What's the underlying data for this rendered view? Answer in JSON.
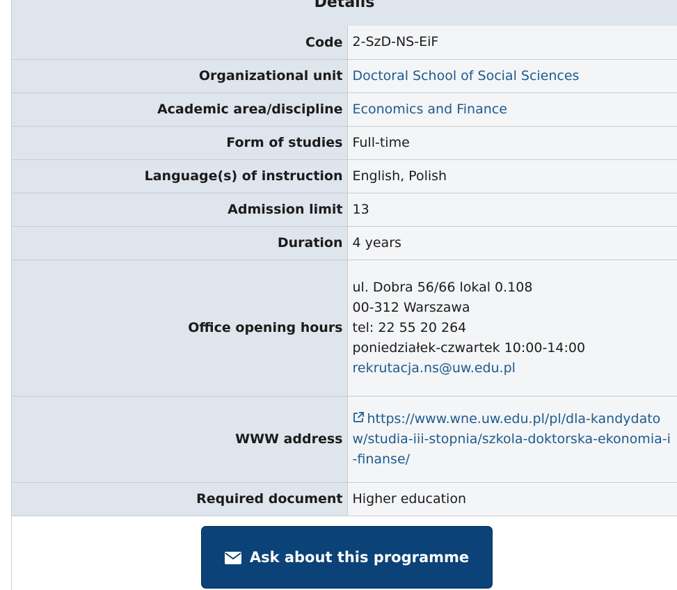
{
  "section_title": "Details",
  "details": {
    "code": {
      "label": "Code",
      "value": "2-SzD-NS-EiF"
    },
    "organizational_unit": {
      "label": "Organizational unit",
      "value": "Doctoral School of Social Sciences"
    },
    "academic_area": {
      "label": "Academic area/discipline",
      "value": "Economics and Finance"
    },
    "form_of_studies": {
      "label": "Form of studies",
      "value": "Full-time"
    },
    "languages": {
      "label": "Language(s) of instruction",
      "value": "English, Polish"
    },
    "admission_limit": {
      "label": "Admission limit",
      "value": "13"
    },
    "duration": {
      "label": "Duration",
      "value": "4 years"
    },
    "office_hours": {
      "label": "Office opening hours",
      "address": "ul. Dobra 56/66 lokal 0.108",
      "city": "00-312 Warszawa",
      "phone": "tel: 22 55 20 264",
      "hours": "poniedziałek-czwartek 10:00-14:00",
      "email": "rekrutacja.ns@uw.edu.pl"
    },
    "www_address": {
      "label": "WWW address",
      "value": "https://www.wne.uw.edu.pl/pl/dla-kandydatow/studia-iii-stopnia/szkola-doktorska-ekonomia-i-finanse/",
      "icon": "external-link-icon"
    },
    "required_document": {
      "label": "Required document",
      "value": "Higher education"
    }
  },
  "ask_button": {
    "label": "Ask about this programme",
    "icon": "envelope-icon"
  },
  "colors": {
    "label_bg": "#dfe5ec",
    "value_bg": "#f4f5f7",
    "border": "#c9ccd1",
    "link": "#1d5a8e",
    "button_bg": "#0b4277",
    "button_text": "#ffffff"
  }
}
